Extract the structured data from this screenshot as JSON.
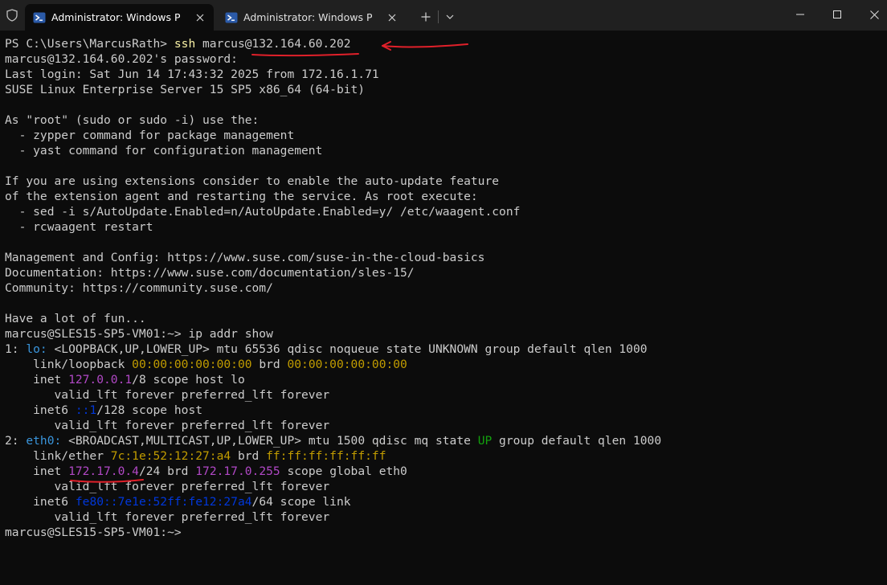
{
  "tabs": [
    {
      "title": "Administrator: Windows PowerShell",
      "active": true
    },
    {
      "title": "Administrator: Windows PowerShell",
      "active": false
    }
  ],
  "titlebar_icons": {
    "shield": "shield-icon",
    "tab_icon": "powershell-icon",
    "close": "close-icon",
    "new_tab": "plus-icon",
    "dropdown": "chevron-down-icon",
    "minimize": "minimize-icon",
    "maximize": "maximize-icon",
    "window_close": "close-icon"
  },
  "colors": {
    "background": "#0c0c0c",
    "titlebar": "#202020",
    "text": "#cccccc",
    "command_yellow": "#f9f1a5",
    "magenta": "#b148c6",
    "gold": "#c19c00",
    "green": "#13a10e",
    "blue": "#3b78ff",
    "annotation_red": "#e0202a"
  },
  "terminal": {
    "lines": [
      [
        {
          "t": "PS C:\\Users\\MarcusRath> ",
          "c": "gray"
        },
        {
          "t": "ssh",
          "c": "yellow"
        },
        {
          "t": " marcus@132.164.60.202",
          "c": "gray"
        }
      ],
      [
        {
          "t": "marcus@132.164.60.202's password:",
          "c": "gray"
        }
      ],
      [
        {
          "t": "Last login: Sat Jun 14 17:43:32 2025 from 172.16.1.71",
          "c": "gray"
        }
      ],
      [
        {
          "t": "SUSE Linux Enterprise Server 15 SP5 x86_64 (64-bit)",
          "c": "gray"
        }
      ],
      [
        {
          "t": "",
          "c": "gray"
        }
      ],
      [
        {
          "t": "As \"root\" (sudo or sudo -i) use the:",
          "c": "gray"
        }
      ],
      [
        {
          "t": "  - zypper command for package management",
          "c": "gray"
        }
      ],
      [
        {
          "t": "  - yast command for configuration management",
          "c": "gray"
        }
      ],
      [
        {
          "t": "",
          "c": "gray"
        }
      ],
      [
        {
          "t": "If you are using extensions consider to enable the auto-update feature",
          "c": "gray"
        }
      ],
      [
        {
          "t": "of the extension agent and restarting the service. As root execute:",
          "c": "gray"
        }
      ],
      [
        {
          "t": "  - sed -i s/AutoUpdate.Enabled=n/AutoUpdate.Enabled=y/ /etc/waagent.conf",
          "c": "gray"
        }
      ],
      [
        {
          "t": "  - rcwaagent restart",
          "c": "gray"
        }
      ],
      [
        {
          "t": "",
          "c": "gray"
        }
      ],
      [
        {
          "t": "Management and Config: https://www.suse.com/suse-in-the-cloud-basics",
          "c": "gray"
        }
      ],
      [
        {
          "t": "Documentation: https://www.suse.com/documentation/sles-15/",
          "c": "gray"
        }
      ],
      [
        {
          "t": "Community: https://community.suse.com/",
          "c": "gray"
        }
      ],
      [
        {
          "t": "",
          "c": "gray"
        }
      ],
      [
        {
          "t": "Have a lot of fun...",
          "c": "gray"
        }
      ],
      [
        {
          "t": "marcus@SLES15-SP5-VM01:~> ip addr show",
          "c": "gray"
        }
      ],
      [
        {
          "t": "1: ",
          "c": "gray"
        },
        {
          "t": "lo:",
          "c": "lblue"
        },
        {
          "t": " <LOOPBACK,UP,LOWER_UP> mtu 65536 qdisc noqueue state UNKNOWN group default qlen 1000",
          "c": "gray"
        }
      ],
      [
        {
          "t": "    link/loopback ",
          "c": "gray"
        },
        {
          "t": "00:00:00:00:00:00",
          "c": "gold"
        },
        {
          "t": " brd ",
          "c": "gray"
        },
        {
          "t": "00:00:00:00:00:00",
          "c": "gold"
        }
      ],
      [
        {
          "t": "    inet ",
          "c": "gray"
        },
        {
          "t": "127.0.0.1",
          "c": "magenta"
        },
        {
          "t": "/8 scope host lo",
          "c": "gray"
        }
      ],
      [
        {
          "t": "       valid_lft forever preferred_lft forever",
          "c": "gray"
        }
      ],
      [
        {
          "t": "    inet6 ",
          "c": "gray"
        },
        {
          "t": "::1",
          "c": "sblue"
        },
        {
          "t": "/128 scope host",
          "c": "gray"
        }
      ],
      [
        {
          "t": "       valid_lft forever preferred_lft forever",
          "c": "gray"
        }
      ],
      [
        {
          "t": "2: ",
          "c": "gray"
        },
        {
          "t": "eth0:",
          "c": "lblue"
        },
        {
          "t": " <BROADCAST,MULTICAST,UP,LOWER_UP> mtu 1500 qdisc mq state ",
          "c": "gray"
        },
        {
          "t": "UP",
          "c": "green"
        },
        {
          "t": " group default qlen 1000",
          "c": "gray"
        }
      ],
      [
        {
          "t": "    link/ether ",
          "c": "gray"
        },
        {
          "t": "7c:1e:52:12:27:a4",
          "c": "gold"
        },
        {
          "t": " brd ",
          "c": "gray"
        },
        {
          "t": "ff:ff:ff:ff:ff:ff",
          "c": "gold"
        }
      ],
      [
        {
          "t": "    inet ",
          "c": "gray"
        },
        {
          "t": "172.17.0.4",
          "c": "magenta"
        },
        {
          "t": "/24 brd ",
          "c": "gray"
        },
        {
          "t": "172.17.0.255",
          "c": "magenta"
        },
        {
          "t": " scope global eth0",
          "c": "gray"
        }
      ],
      [
        {
          "t": "       valid_lft forever preferred_lft forever",
          "c": "gray"
        }
      ],
      [
        {
          "t": "    inet6 ",
          "c": "gray"
        },
        {
          "t": "fe80::7e1e:52ff:fe12:27a4",
          "c": "sblue"
        },
        {
          "t": "/64 scope link",
          "c": "gray"
        }
      ],
      [
        {
          "t": "       valid_lft forever preferred_lft forever",
          "c": "gray"
        }
      ],
      [
        {
          "t": "marcus@SLES15-SP5-VM01:~> ",
          "c": "gray"
        }
      ]
    ]
  }
}
